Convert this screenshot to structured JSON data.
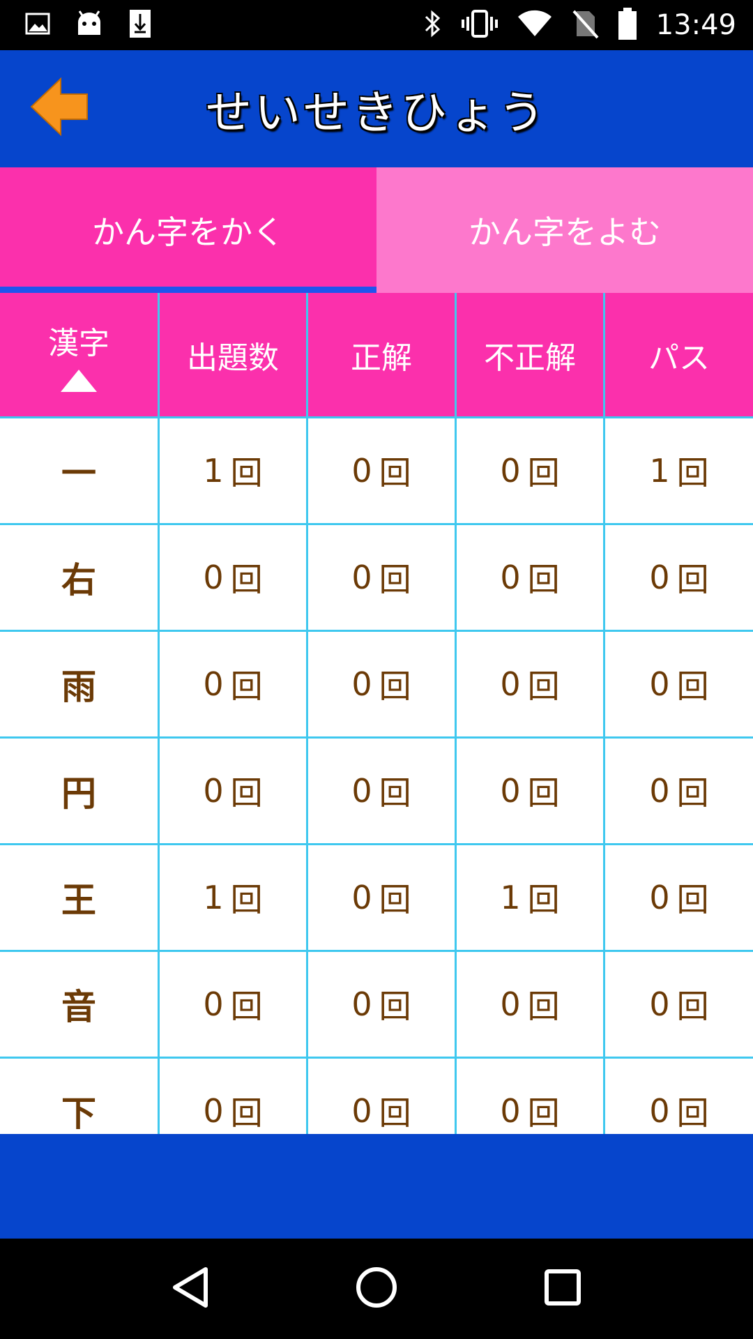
{
  "status_bar": {
    "time": "13:49",
    "icons_left": [
      "image-icon",
      "android-icon",
      "download-icon"
    ],
    "icons_right": [
      "bluetooth-icon",
      "vibrate-icon",
      "wifi-icon",
      "no-sim-icon",
      "battery-icon"
    ]
  },
  "app_bar": {
    "title": "せいせきひょう",
    "back_icon": "back-arrow-icon"
  },
  "tabs": [
    {
      "label": "かん字をかく",
      "active": true
    },
    {
      "label": "かん字をよむ",
      "active": false
    }
  ],
  "table": {
    "headers": {
      "kanji": "漢字",
      "asked": "出題数",
      "correct": "正解",
      "incorrect": "不正解",
      "pass": "パス"
    },
    "sort": "ascending",
    "unit": "回",
    "rows": [
      {
        "kanji": "一",
        "asked": "1",
        "correct": "0",
        "incorrect": "0",
        "pass": "1"
      },
      {
        "kanji": "右",
        "asked": "0",
        "correct": "0",
        "incorrect": "0",
        "pass": "0"
      },
      {
        "kanji": "雨",
        "asked": "0",
        "correct": "0",
        "incorrect": "0",
        "pass": "0"
      },
      {
        "kanji": "円",
        "asked": "0",
        "correct": "0",
        "incorrect": "0",
        "pass": "0"
      },
      {
        "kanji": "王",
        "asked": "1",
        "correct": "0",
        "incorrect": "1",
        "pass": "0"
      },
      {
        "kanji": "音",
        "asked": "0",
        "correct": "0",
        "incorrect": "0",
        "pass": "0"
      },
      {
        "kanji": "下",
        "asked": "0",
        "correct": "0",
        "incorrect": "0",
        "pass": "0"
      }
    ]
  },
  "colors": {
    "app_bar": "#0645cc",
    "tab_active": "#fb30ac",
    "tab_inactive": "#fd78cc",
    "grid_line": "#3fc8ef",
    "cell_text": "#6b3a06",
    "back_arrow": "#f7941d"
  },
  "nav_bar": {
    "icons": [
      "nav-back-icon",
      "nav-home-icon",
      "nav-recents-icon"
    ]
  }
}
